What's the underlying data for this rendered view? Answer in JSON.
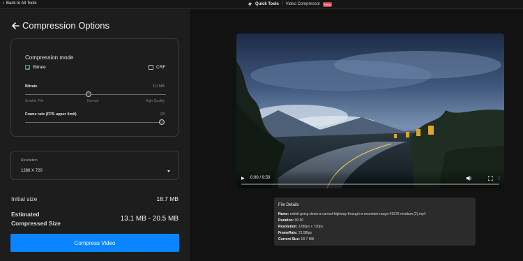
{
  "topbar": {
    "back_label": "Back to All Tools",
    "quick_tools": "Quick Tools",
    "separator": "/",
    "current_tool": "Video Compressor",
    "badge": "beta"
  },
  "panel": {
    "title": "Compression Options",
    "mode_title": "Compression mode",
    "bitrate_label": "Bitrate",
    "bitrate_checked": true,
    "crf_label": "CRF",
    "crf_checked": false,
    "bitrate_slider": {
      "label": "Bitrate",
      "value": "3.0 MB",
      "position_fraction": 0.45,
      "ticks": [
        "Smaller File",
        "Normal",
        "High Quality"
      ]
    },
    "framerate_slider": {
      "label": "Frame rate (FPS upper limit)",
      "value": "23",
      "position_fraction": 1.0
    },
    "resolution": {
      "label": "Resolution",
      "value": "1280 X 720"
    },
    "initial_size_label": "Initial size",
    "initial_size_value": "18.7 MB",
    "estimated_label_line1": "Estimated",
    "estimated_label_line2": "Compressed Size",
    "estimated_value": "13.1 MB - 20.5 MB",
    "compress_button": "Compress Video"
  },
  "player": {
    "time": "0:00 / 0:50",
    "play_icon": "play-icon",
    "mute_icon": "volume-icon",
    "fullscreen_icon": "fullscreen-icon",
    "more_icon": "more-vert-icon"
  },
  "file_details": {
    "title": "File Details",
    "rows": [
      {
        "k": "Name:",
        "v": "mixkit-going-down-a-curved-highway-through-a-mountain-range-41576-medium (2).mp4"
      },
      {
        "k": "Duration:",
        "v": "00:50"
      },
      {
        "k": "Resolution:",
        "v": "1280px x 720px"
      },
      {
        "k": "FrameRate:",
        "v": "23.98fps"
      },
      {
        "k": "Current Size:",
        "v": "18.7 MB"
      }
    ]
  },
  "colors": {
    "accent": "#0a84ff",
    "check_green": "#22c55e",
    "beta_red": "#e0343e"
  }
}
